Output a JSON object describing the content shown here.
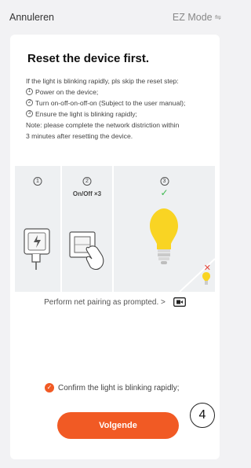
{
  "header": {
    "cancel_label": "Annuleren",
    "mode_label": "EZ Mode",
    "mode_icon": "swap-arrows-icon"
  },
  "card": {
    "title": "Reset the device first.",
    "intro": "If the light is blinking rapidly, pls skip the reset step:",
    "steps": [
      {
        "num": "1",
        "text": "Power on the device;"
      },
      {
        "num": "2",
        "text": "Turn on-off-on-off-on (Subject to the user manual);"
      },
      {
        "num": "3",
        "text": "Ensure the light is blinking rapidly;"
      }
    ],
    "note_line1": "Note: please complete the network distriction within",
    "note_line2": "3 minutes after resetting the device."
  },
  "illustration": {
    "panel1_num": "1",
    "panel2_num": "2",
    "panel2_sub": "On/Off ×3",
    "panel3_num": "3"
  },
  "pairing_link": "Perform net pairing as prompted. >",
  "confirm_text": "Confirm the light is blinking rapidly;",
  "next_button": "Volgende",
  "step_badge": "4",
  "colors": {
    "accent": "#f15a24",
    "check_green": "#3fb950",
    "bulb_yellow": "#f9d423",
    "error_red": "#e4453a"
  }
}
